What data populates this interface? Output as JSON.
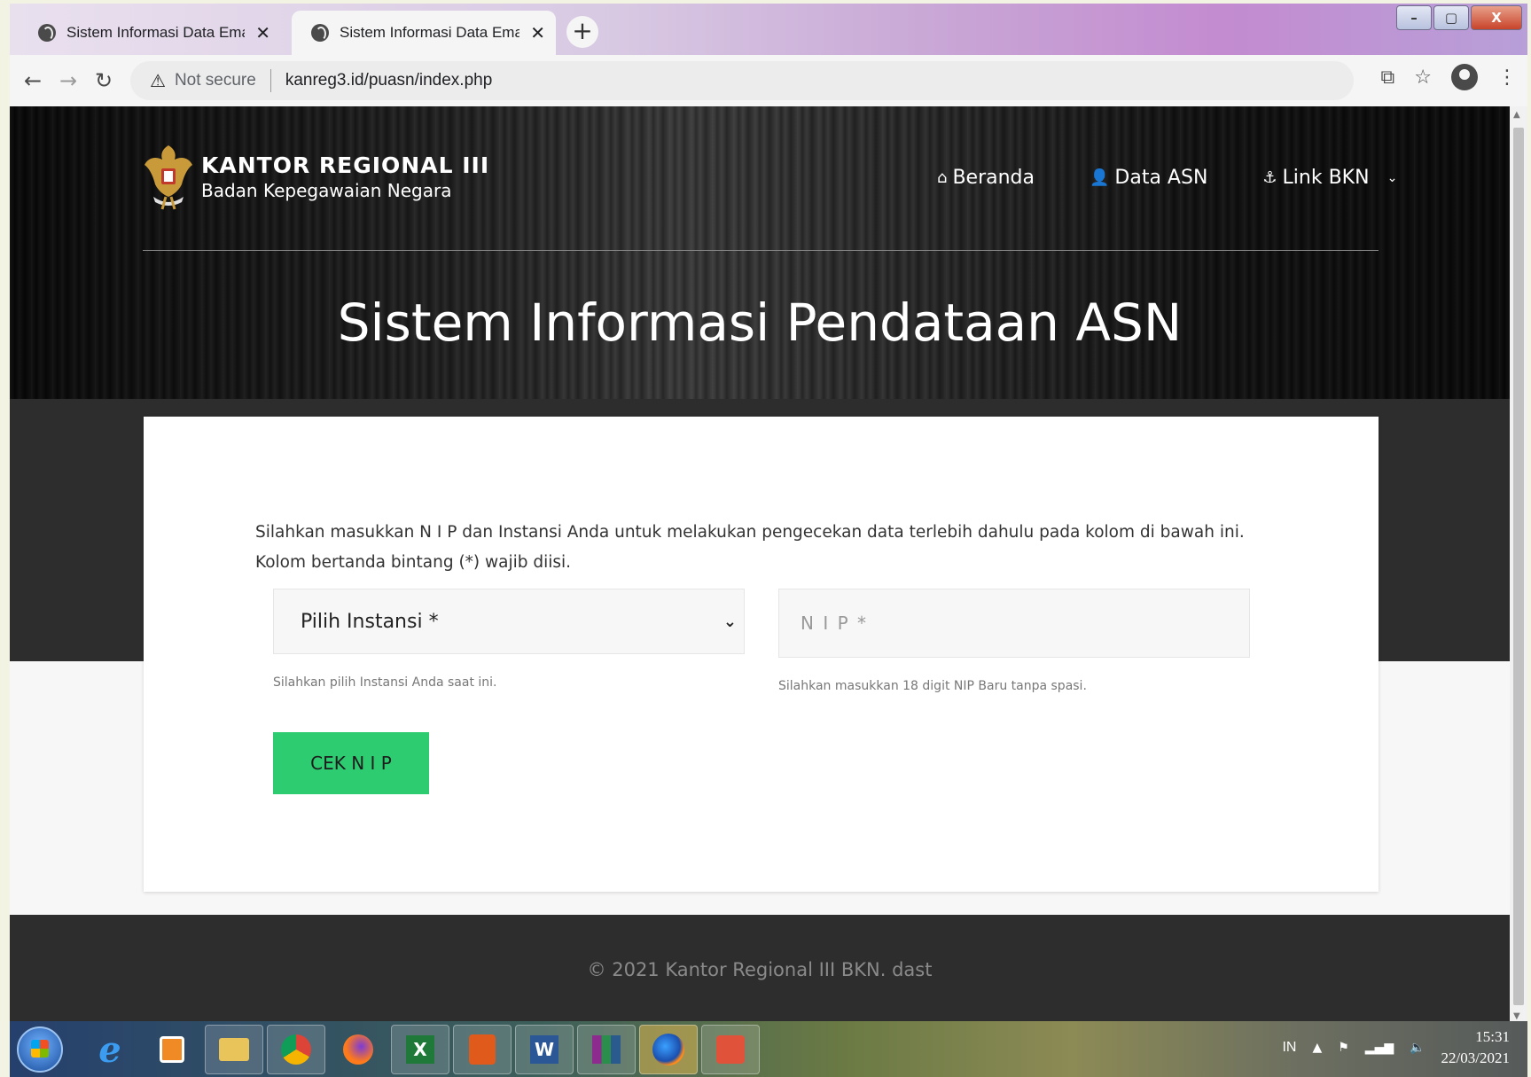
{
  "browser": {
    "tabs": [
      {
        "title": "Sistem Informasi Data Email ASN",
        "active": false
      },
      {
        "title": "Sistem Informasi Data Email ASN",
        "active": true
      }
    ],
    "tab_close": "✕",
    "new_tab": "+",
    "security_label": "Not secure",
    "url": "kanreg3.id/puasn/index.php",
    "window_buttons": {
      "minimize": "–",
      "maximize": "▢",
      "close": "X"
    }
  },
  "site": {
    "brand_title": "KANTOR REGIONAL III",
    "brand_subtitle": "Badan Kepegawaian Negara",
    "nav": [
      {
        "label": "Beranda",
        "icon": "home-icon"
      },
      {
        "label": "Data ASN",
        "icon": "user-icon"
      },
      {
        "label": "Link BKN",
        "icon": "anchor-icon"
      }
    ],
    "hero_title": "Sistem Informasi Pendataan ASN"
  },
  "form": {
    "intro": "Silahkan masukkan N I P dan Instansi Anda untuk melakukan pengecekan data terlebih dahulu pada kolom di bawah ini. Kolom bertanda bintang (*) wajib diisi.",
    "instansi_selected": "Pilih Instansi *",
    "instansi_help": "Silahkan pilih Instansi Anda saat ini.",
    "nip_placeholder": "N I P *",
    "nip_help": "Silahkan masukkan 18 digit NIP Baru tanpa spasi.",
    "submit_label": "CEK N I P"
  },
  "footer": {
    "copyright": "© 2021 Kantor Regional III BKN. dast"
  },
  "taskbar": {
    "language": "IN",
    "time": "15:31",
    "date": "22/03/2021"
  },
  "colors": {
    "accent_green": "#2ecc71",
    "hero_dark": "#1a1a1a",
    "band_gray": "#2d2d2d"
  }
}
